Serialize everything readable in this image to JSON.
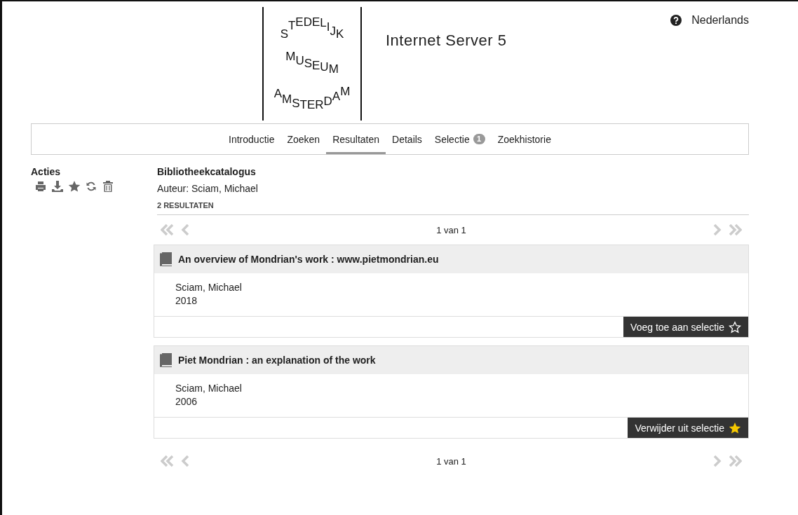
{
  "header": {
    "logo_lines": [
      "STEDELIJK",
      "MUSEUM",
      "AMSTERDAM"
    ],
    "title": "Internet Server 5",
    "language": "Nederlands"
  },
  "tabs": [
    {
      "label": "Introductie",
      "selected": false
    },
    {
      "label": "Zoeken",
      "selected": false
    },
    {
      "label": "Resultaten",
      "selected": true
    },
    {
      "label": "Details",
      "selected": false
    },
    {
      "label": "Selectie",
      "selected": false,
      "badge": "1"
    },
    {
      "label": "Zoekhistorie",
      "selected": false
    }
  ],
  "sidebar": {
    "title": "Acties",
    "actions": [
      {
        "kind": "print"
      },
      {
        "kind": "download"
      },
      {
        "kind": "star"
      },
      {
        "kind": "refresh"
      },
      {
        "kind": "trash"
      }
    ]
  },
  "results": {
    "catalog": "Bibliotheekcatalogus",
    "query": "Auteur: Sciam, Michael",
    "count": "2 RESULTATEN",
    "pager_top": "1 van 1",
    "pager_bottom": "1 van 1",
    "items": [
      {
        "title": "An overview of Mondrian's work : www.pietmondrian.eu",
        "author": "Sciam, Michael",
        "year": "2018",
        "action": "Voeg toe aan selectie",
        "selected": false
      },
      {
        "title": "Piet Mondrian : an explanation of the work",
        "author": "Sciam, Michael",
        "year": "2006",
        "action": "Verwijder uit selectie",
        "selected": true
      }
    ]
  }
}
